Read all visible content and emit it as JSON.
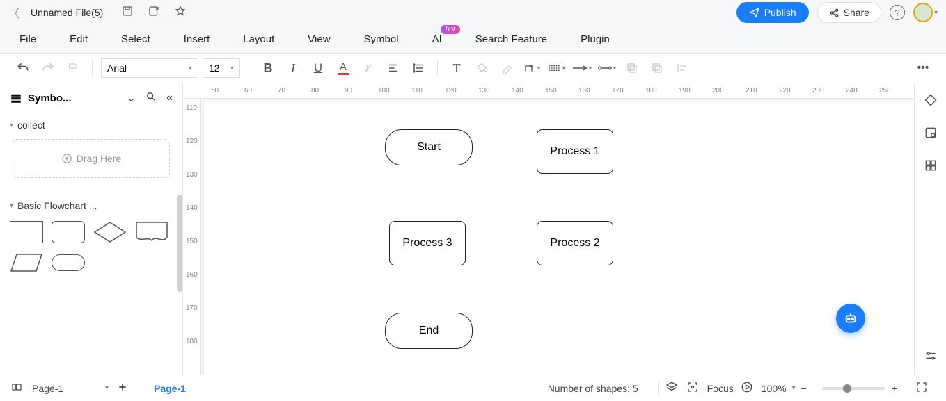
{
  "top": {
    "filename": "Unnamed File(5)",
    "publish": "Publish",
    "share": "Share"
  },
  "menu": {
    "file": "File",
    "edit": "Edit",
    "select": "Select",
    "insert": "Insert",
    "layout": "Layout",
    "view": "View",
    "symbol": "Symbol",
    "ai": "AI",
    "hot": "hot",
    "search": "Search Feature",
    "plugin": "Plugin"
  },
  "toolbar": {
    "font": "Arial",
    "size": "12"
  },
  "left": {
    "title": "Symbo...",
    "collect": "collect",
    "drag_here": "Drag Here",
    "basic": "Basic Flowchart ..."
  },
  "ruler_h": [
    "50",
    "60",
    "70",
    "80",
    "90",
    "100",
    "110",
    "120",
    "130",
    "140",
    "150",
    "160",
    "170",
    "180",
    "190",
    "200",
    "210",
    "220",
    "230",
    "240",
    "250"
  ],
  "ruler_v": [
    "110",
    "120",
    "130",
    "140",
    "150",
    "160",
    "170",
    "180"
  ],
  "nodes": {
    "start": "Start",
    "p1": "Process 1",
    "p2": "Process 2",
    "p3": "Process 3",
    "end": "End"
  },
  "bottom": {
    "page_sel": "Page-1",
    "page_tab": "Page-1",
    "shape_count": "Number of shapes: 5",
    "focus": "Focus",
    "zoom": "100%"
  }
}
